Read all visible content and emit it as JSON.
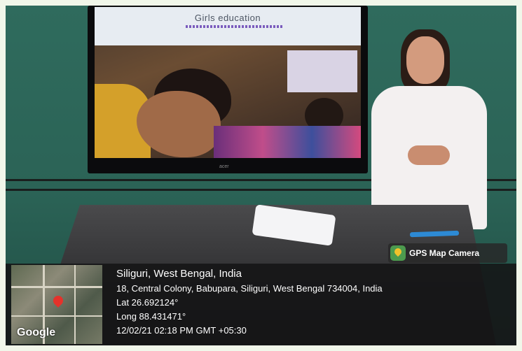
{
  "slide": {
    "title": "Girls education"
  },
  "tv": {
    "brand": "acer"
  },
  "gps_badge": {
    "label": "GPS Map Camera"
  },
  "map": {
    "logo_text": "Google"
  },
  "location": {
    "title": "Siliguri, West Bengal, India",
    "address": "18, Central Colony, Babupara, Siliguri, West Bengal 734004, India",
    "lat": "Lat 26.692124°",
    "long": "Long 88.431471°",
    "datetime": "12/02/21 02:18 PM GMT +05:30"
  },
  "colors": {
    "wall": "#2f6b5d",
    "panel": "#141416",
    "badge_accent": "#4c9a4e"
  }
}
